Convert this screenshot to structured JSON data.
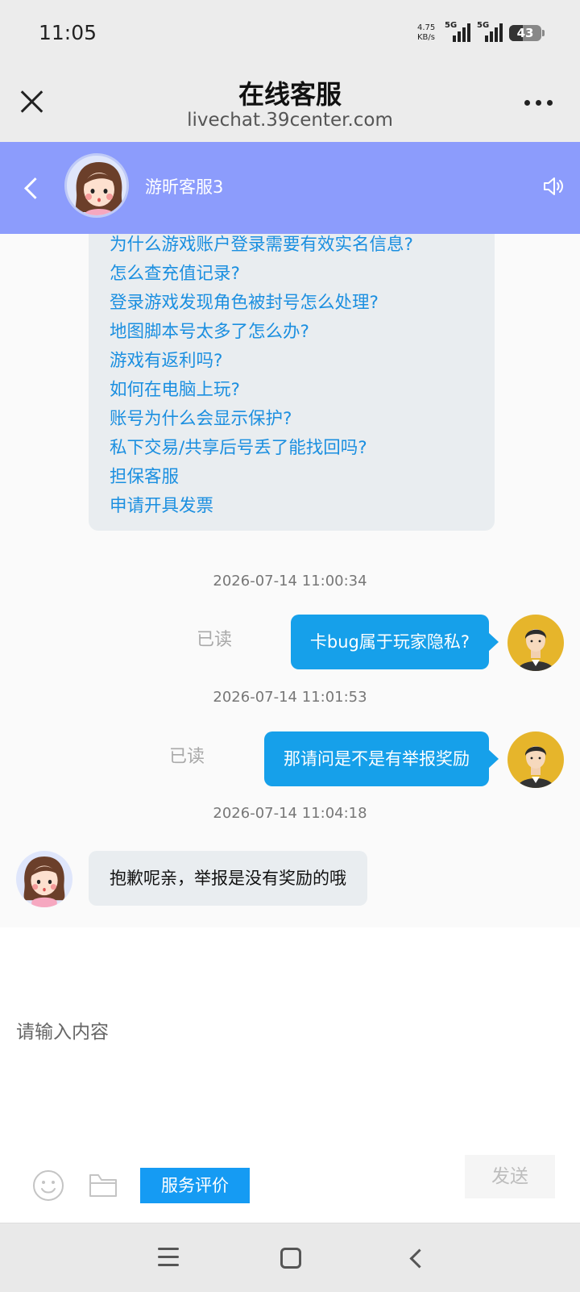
{
  "status_bar": {
    "time": "11:05",
    "net_speed_value": "4.75",
    "net_speed_unit": "KB/s",
    "sim1_label": "5G",
    "sim2_label": "5G",
    "battery": "43"
  },
  "browser": {
    "title": "在线客服",
    "url": "livechat.39center.com"
  },
  "chat_header": {
    "agent_name": "游昕客服3",
    "bg_color": "#8c9cfc"
  },
  "faq": {
    "items": [
      "为什么游戏账户登录需要有效实名信息?",
      "怎么查充值记录?",
      "登录游戏发现角色被封号怎么处理?",
      "地图脚本号太多了怎么办?",
      "游戏有返利吗?",
      "如何在电脑上玩?",
      "账号为什么会显示保护?",
      "私下交易/共享后号丢了能找回吗?",
      "担保客服",
      "申请开具发票"
    ]
  },
  "messages": [
    {
      "timestamp": "2026-07-14 11:00:34",
      "text": "卡bug属于玩家隐私?",
      "status": "已读"
    },
    {
      "timestamp": "2026-07-14 11:01:53",
      "text": "那请问是不是有举报奖励",
      "status": "已读"
    },
    {
      "timestamp": "2026-07-14 11:04:18",
      "text": "抱歉呢亲，举报是没有奖励的哦"
    }
  ],
  "input": {
    "placeholder": "请输入内容",
    "rate_label": "服务评价",
    "send_label": "发送"
  },
  "colors": {
    "accent": "#16a0ea",
    "link": "#1b8fe0"
  }
}
